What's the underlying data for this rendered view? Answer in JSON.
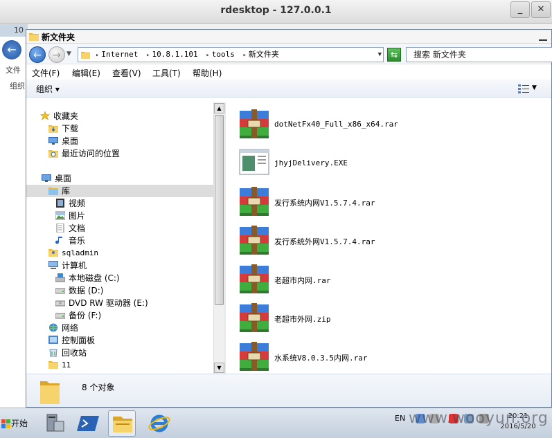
{
  "rdesktop": {
    "title": "rdesktop - 127.0.0.1"
  },
  "background_window": {
    "title_fragment": "10",
    "menu_fragment": "文件",
    "toolbar_fragment": "组织"
  },
  "window": {
    "title": "新文件夹",
    "address": {
      "segments": [
        "Internet",
        "10.8.1.101",
        "tools",
        "新文件夹"
      ]
    },
    "search": {
      "placeholder": "搜索 新文件夹"
    },
    "menu": [
      "文件(F)",
      "编辑(E)",
      "查看(V)",
      "工具(T)",
      "帮助(H)"
    ],
    "toolbar": {
      "organize": "组织"
    }
  },
  "tree": {
    "favorites": "收藏夹",
    "downloads": "下载",
    "desktop_fav": "桌面",
    "recent": "最近访问的位置",
    "desktop": "桌面",
    "library": "库",
    "videos": "视频",
    "pictures": "图片",
    "documents": "文档",
    "music": "音乐",
    "sqladmin": "sqladmin",
    "computer": "计算机",
    "disk_c": "本地磁盘 (C:)",
    "disk_d": "数据 (D:)",
    "dvd": "DVD RW 驱动器 (E:)",
    "disk_f": "备份 (F:)",
    "network": "网络",
    "control_panel": "控制面板",
    "recycle_bin": "回收站",
    "folder_11": "11"
  },
  "files": [
    {
      "name": "dotNetFx40_Full_x86_x64.rar",
      "icon": "winrar-icon"
    },
    {
      "name": "jhyjDelivery.EXE",
      "icon": "exe-icon"
    },
    {
      "name": "发行系统内网V1.5.7.4.rar",
      "icon": "winrar-icon"
    },
    {
      "name": "发行系统外网V1.5.7.4.rar",
      "icon": "winrar-icon"
    },
    {
      "name": "老超市内网.rar",
      "icon": "winrar-icon"
    },
    {
      "name": "老超市外网.zip",
      "icon": "winrar-icon"
    },
    {
      "name": "水系统V8.0.3.5内网.rar",
      "icon": "winrar-icon"
    }
  ],
  "details": {
    "count": "8 个对象"
  },
  "taskbar": {
    "start": "开始",
    "lang": "EN",
    "time": "20:21",
    "date": "2016/5/20",
    "watermark": "www.wooyun.org"
  },
  "colors": {
    "accent": "#1f5cb5",
    "selection": "#dcdcdc",
    "taskbar": "#c3cfdd"
  }
}
